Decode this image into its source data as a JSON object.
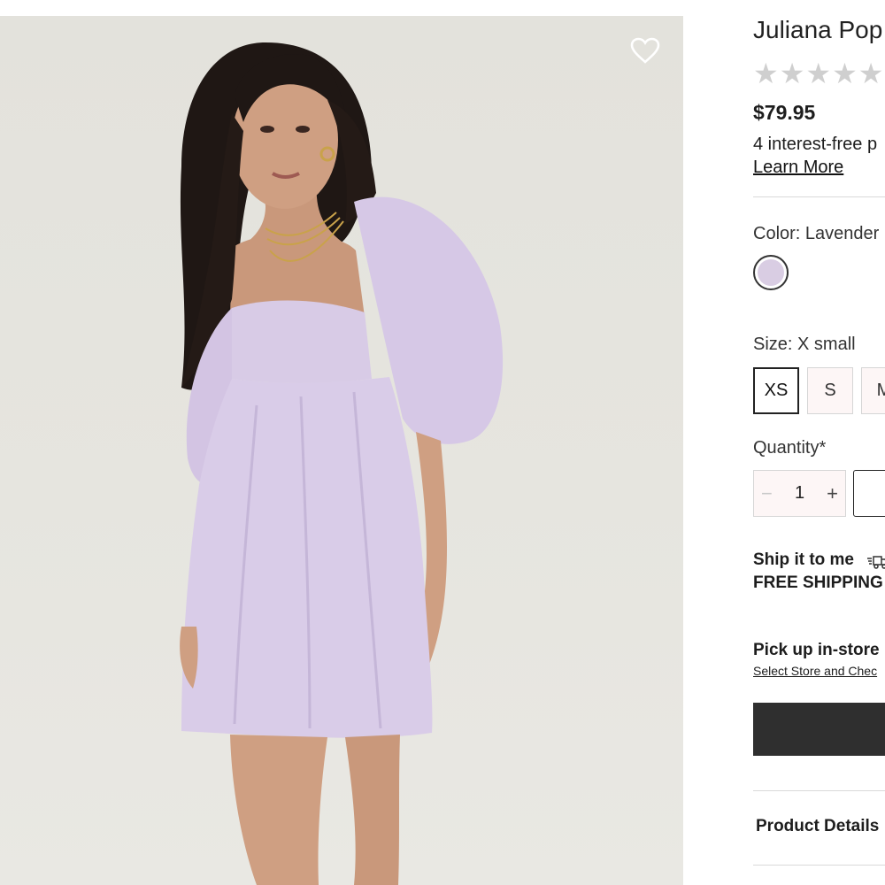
{
  "product": {
    "title": "Juliana Pop",
    "rating_stars": "★★★★★",
    "price": "$79.95",
    "installments_text": "4 interest-free p",
    "learn_more": "Learn More"
  },
  "color": {
    "label": "Color: Lavender",
    "swatch_color": "#d9cde3"
  },
  "size": {
    "label": "Size: X small",
    "options": [
      "XS",
      "S",
      "M"
    ],
    "selected": "XS"
  },
  "quantity": {
    "label": "Quantity*",
    "value": "1",
    "minus": "−",
    "plus": "+"
  },
  "shipping": {
    "ship_label": "Ship it to me",
    "free_label": "FREE SHIPPING",
    "pickup_label": "Pick up in-store",
    "store_link": "Select Store and Chec"
  },
  "accordion": {
    "details_label": "Product Details"
  },
  "colors": {
    "dress": "#d8cbe6",
    "background": "#e4e3dd",
    "cta": "#2f2f2f"
  },
  "icons": {
    "favorite": "heart-icon",
    "shipping": "fast-truck-icon"
  }
}
